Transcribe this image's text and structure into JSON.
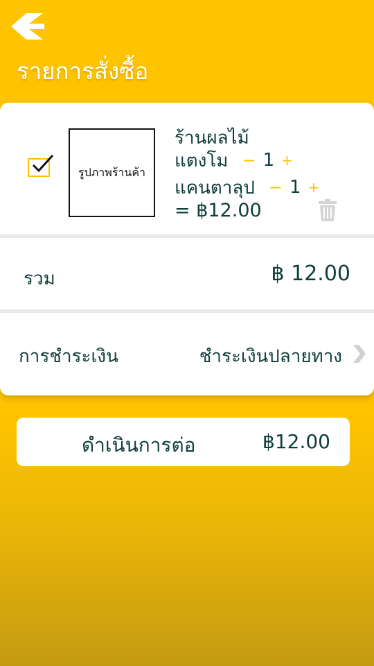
{
  "header": {
    "back_icon": "chevron-left-icon",
    "title": "รายการสั่งซื้อ"
  },
  "cart": {
    "selected": true,
    "shop_image_placeholder": "รูปภาพร้านค้า",
    "shop_name": "ร้านผลไม้",
    "items": [
      {
        "name": "แตงโม",
        "minus": "−",
        "qty": "1",
        "plus": "+"
      },
      {
        "name": "แคนตาลุป",
        "minus": "−",
        "qty": "1",
        "plus": "+"
      }
    ],
    "item_total": "= ฿12.00",
    "delete_icon": "trash-icon"
  },
  "summary": {
    "total_label": "รวม",
    "total_value": "฿ 12.00"
  },
  "payment": {
    "label": "การชำระเงิน",
    "value": "ชำระเงินปลายทาง",
    "chevron_icon": "chevron-right-icon"
  },
  "proceed": {
    "label": "ดำเนินการต่อ",
    "amount": "฿12.00"
  },
  "colors": {
    "accent": "#FFC400",
    "text": "#0E3D3A",
    "divider": "#E8E8E8"
  }
}
